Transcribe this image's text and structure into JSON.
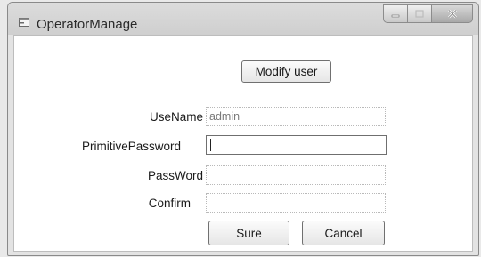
{
  "window": {
    "title": "OperatorManage",
    "icons": {
      "app": "form-icon",
      "minimize": "minimize-icon",
      "maximize": "maximize-icon",
      "close": "close-icon"
    }
  },
  "toolbar": {
    "modify_label": "Modify user"
  },
  "form": {
    "username": {
      "label": "UseName",
      "value": "admin"
    },
    "primitive_password": {
      "label": "PrimitivePassword",
      "value": ""
    },
    "password": {
      "label": "PassWord",
      "value": ""
    },
    "confirm": {
      "label": "Confirm",
      "value": ""
    }
  },
  "actions": {
    "sure_label": "Sure",
    "cancel_label": "Cancel"
  }
}
